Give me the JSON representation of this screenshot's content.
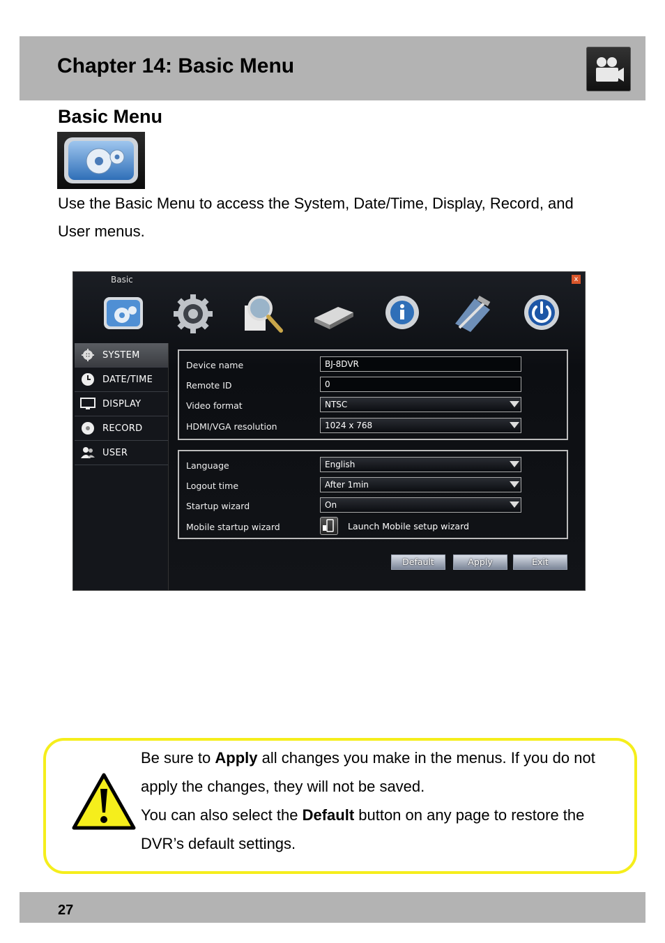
{
  "header": {
    "chapter_title": "Chapter 14: Basic Menu",
    "icon": "video-camera-icon"
  },
  "section": {
    "heading": "Basic Menu",
    "icon": "basic-menu-gear-icon",
    "intro": "Use the Basic Menu to access the System, Date/Time, Display, Record, and User menus."
  },
  "dvr": {
    "window_title": "Basic",
    "close_label": "x",
    "toolbar_icons": [
      "basic-gear-icon",
      "advanced-gear-icon",
      "search-magnifier-icon",
      "hard-drive-icon",
      "info-icon",
      "tools-icon",
      "power-icon"
    ],
    "sidebar": [
      {
        "label": "SYSTEM",
        "icon": "gear-icon",
        "active": true
      },
      {
        "label": "DATE/TIME",
        "icon": "clock-icon",
        "active": false
      },
      {
        "label": "DISPLAY",
        "icon": "monitor-icon",
        "active": false
      },
      {
        "label": "RECORD",
        "icon": "record-icon",
        "active": false
      },
      {
        "label": "USER",
        "icon": "users-icon",
        "active": false
      }
    ],
    "group1": [
      {
        "label": "Device name",
        "value": "BJ-8DVR",
        "type": "text"
      },
      {
        "label": "Remote ID",
        "value": "0",
        "type": "text"
      },
      {
        "label": "Video format",
        "value": "NTSC",
        "type": "select"
      },
      {
        "label": "HDMI/VGA resolution",
        "value": "1024 x 768",
        "type": "select"
      }
    ],
    "group2": [
      {
        "label": "Language",
        "value": "English",
        "type": "select"
      },
      {
        "label": "Logout time",
        "value": "After 1min",
        "type": "select"
      },
      {
        "label": "Startup wizard",
        "value": "On",
        "type": "select"
      },
      {
        "label": "Mobile startup wizard",
        "value": "Launch Mobile setup wizard",
        "type": "button"
      }
    ],
    "buttons": {
      "default": "Default",
      "apply": "Apply",
      "exit": "Exit"
    }
  },
  "note": {
    "icon": "warning-icon",
    "p1_before": "Be sure to ",
    "p1_bold": "Apply",
    "p1_after": " all changes you make in the menus. If you do not apply the changes, they will not be saved.",
    "p2_before": "You can also select the ",
    "p2_bold": "Default",
    "p2_after": " button on any page to restore the DVR’s default settings."
  },
  "footer": {
    "page_number": "27"
  }
}
